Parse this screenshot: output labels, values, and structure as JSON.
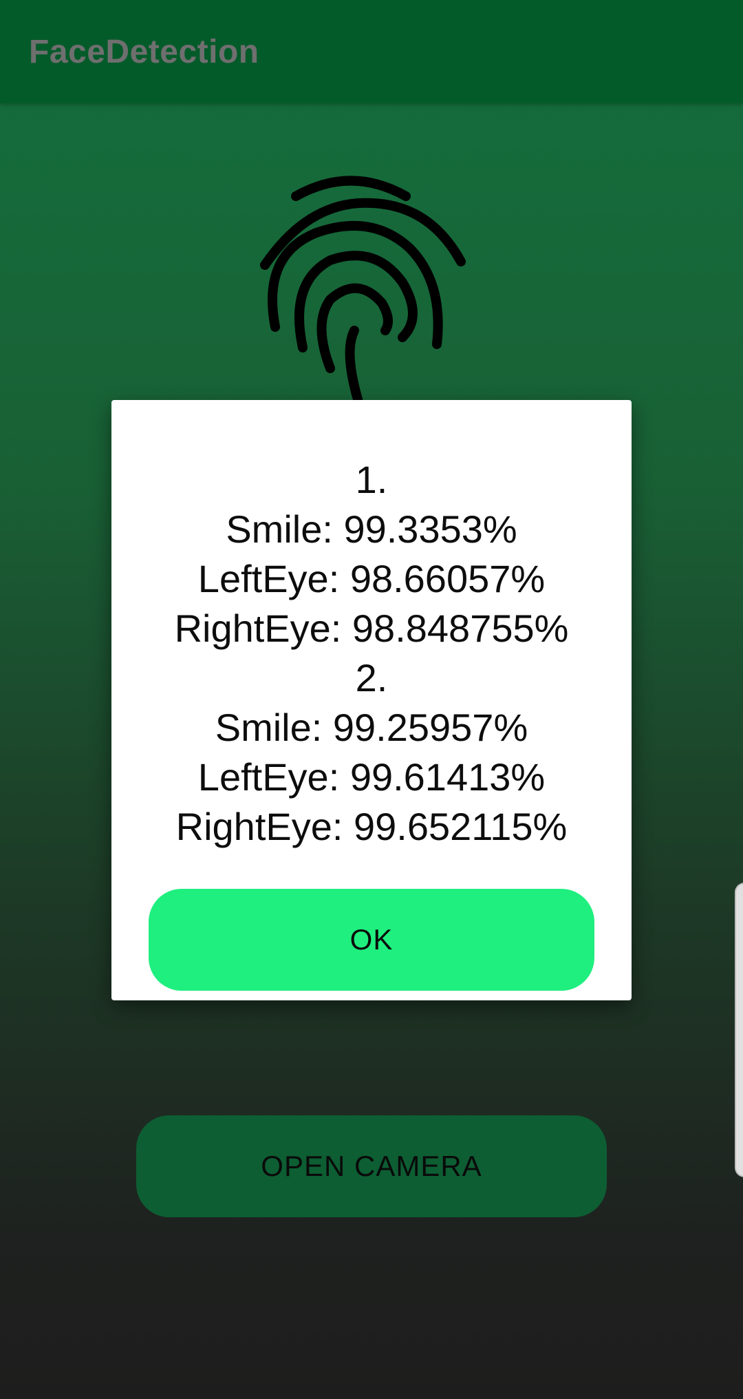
{
  "app": {
    "title": "FaceDetection"
  },
  "main": {
    "fingerprint_icon": "fingerprint-icon",
    "open_camera_label": "OPEN CAMERA"
  },
  "dialog": {
    "lines": [
      "1.",
      "Smile: 99.3353%",
      "LeftEye: 98.66057%",
      "RightEye: 98.848755%",
      "2.",
      "Smile: 99.25957%",
      "LeftEye: 99.61413%",
      "RightEye: 99.652115%"
    ],
    "ok_label": "OK"
  },
  "colors": {
    "app_bar": "#045b2a",
    "ok_button": "#1fef7f",
    "camera_button": "#0d5e33"
  }
}
